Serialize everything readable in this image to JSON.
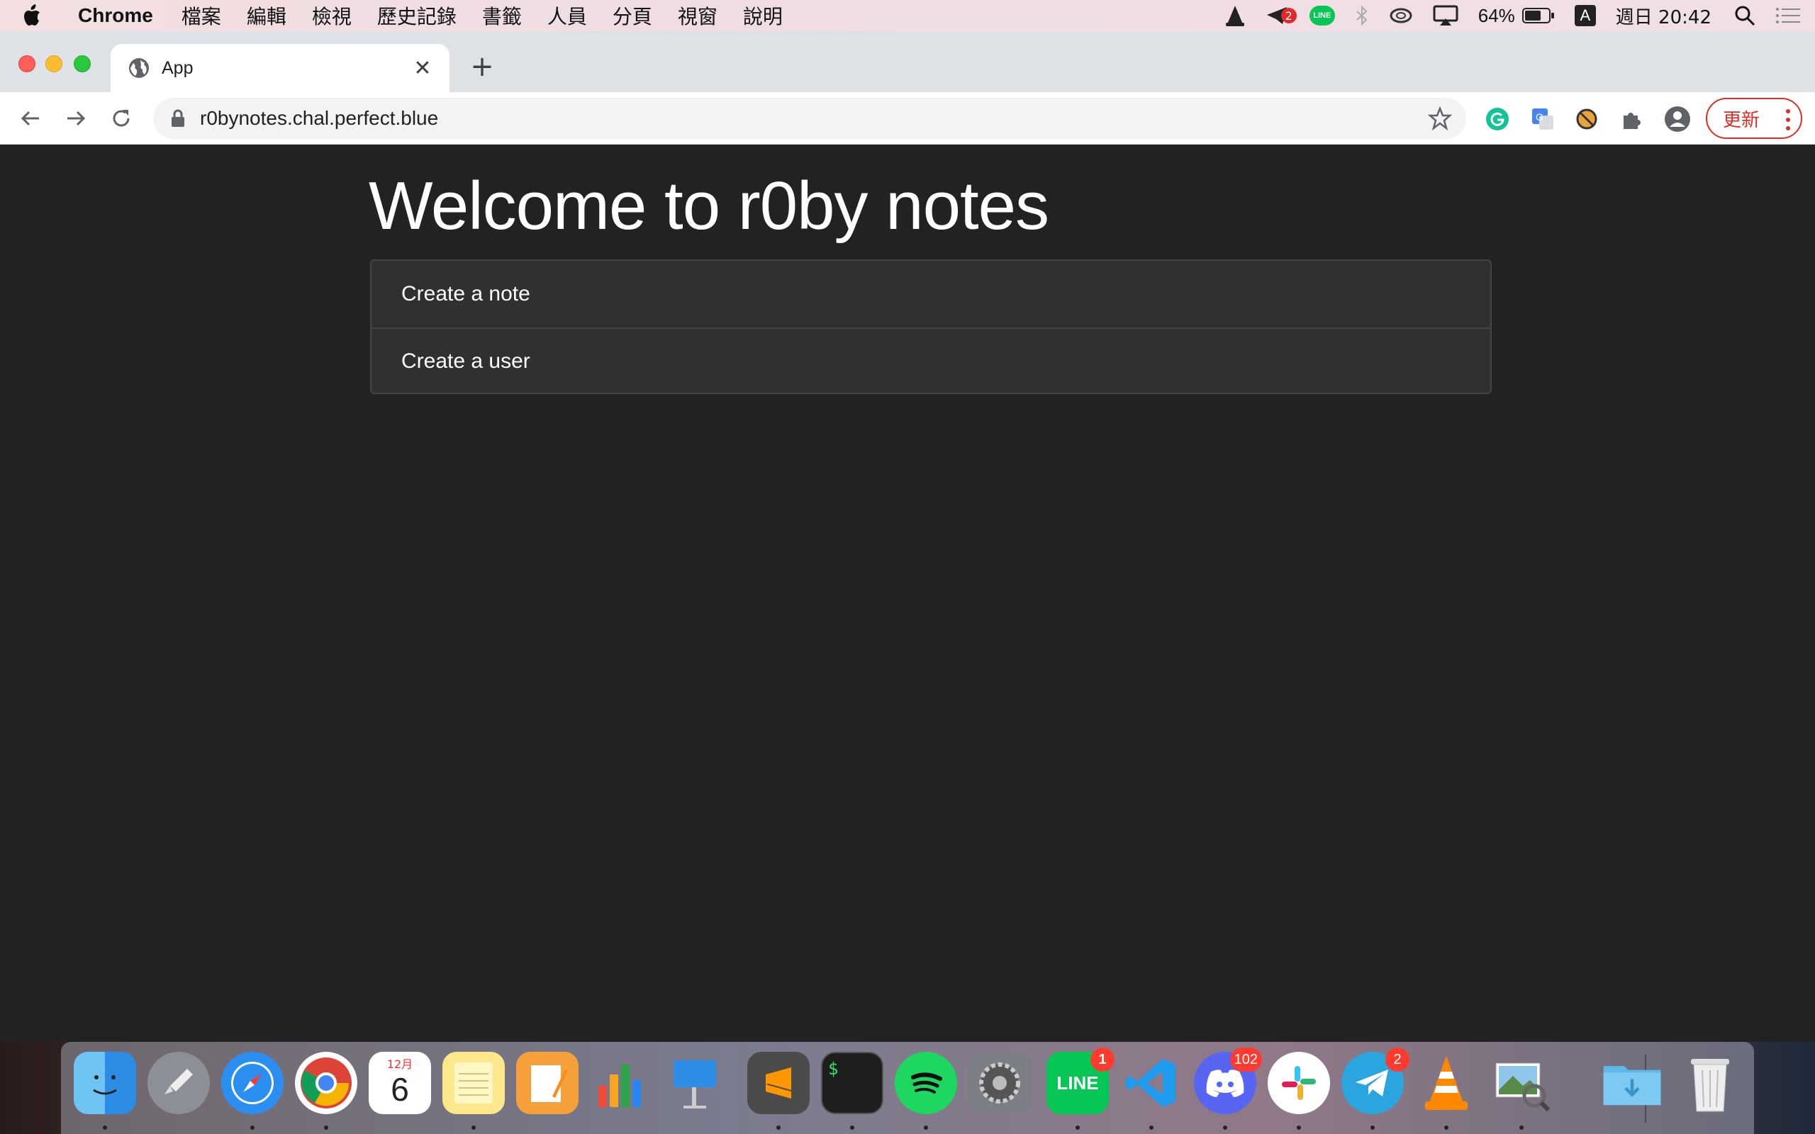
{
  "menubar": {
    "app_name": "Chrome",
    "items": [
      "檔案",
      "編輯",
      "檢視",
      "歷史記錄",
      "書籤",
      "人員",
      "分頁",
      "視窗",
      "說明"
    ],
    "telegram_badge": "2",
    "line_label": "LINE",
    "battery": "64%",
    "input_source": "A",
    "clock": "週日 20:42"
  },
  "browser": {
    "tab_title": "App",
    "tab_close": "✕",
    "new_tab": "+",
    "url": "r0bynotes.chal.perfect.blue",
    "update_label": "更新"
  },
  "page": {
    "heading": "Welcome to r0by notes",
    "links": [
      {
        "label": "Create a note"
      },
      {
        "label": "Create a user"
      }
    ]
  },
  "dock": {
    "calendar_month": "12月",
    "calendar_day": "6",
    "line_badge": "1",
    "discord_badge": "102",
    "telegram_badge": "2",
    "line_text": "LINE",
    "terminal_text": "$"
  },
  "colors": {
    "page_bg": "#222222",
    "list_bg": "#303030",
    "update_red": "#d93025"
  }
}
